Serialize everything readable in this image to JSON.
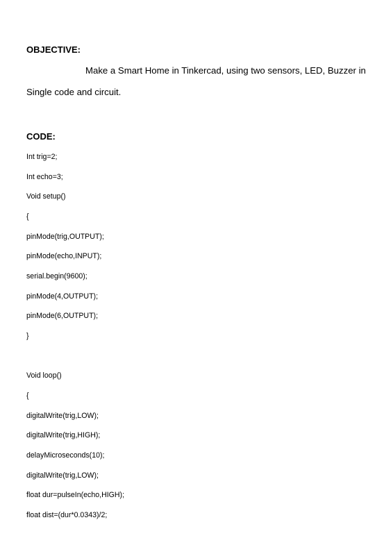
{
  "objective": {
    "heading": "OBJECTIVE:",
    "line1": "Make a Smart Home in Tinkercad, using two sensors, LED, Buzzer in",
    "line2": "Single code and circuit."
  },
  "code": {
    "heading": "CODE:",
    "lines": [
      "Int trig=2;",
      "Int echo=3;",
      "Void setup()",
      "{",
      "pinMode(trig,OUTPUT);",
      "pinMode(echo,INPUT);",
      "serial.begin(9600);",
      "pinMode(4,OUTPUT);",
      "pinMode(6,OUTPUT);",
      "}",
      "Void loop()",
      "{",
      "digitalWrite(trig,LOW);",
      "digitalWrite(trig,HIGH);",
      "delayMicroseconds(10);",
      "digitalWrite(trig,LOW);",
      "float dur=pulseIn(echo,HIGH);",
      "float dist=(dur*0.0343)/2;"
    ]
  }
}
